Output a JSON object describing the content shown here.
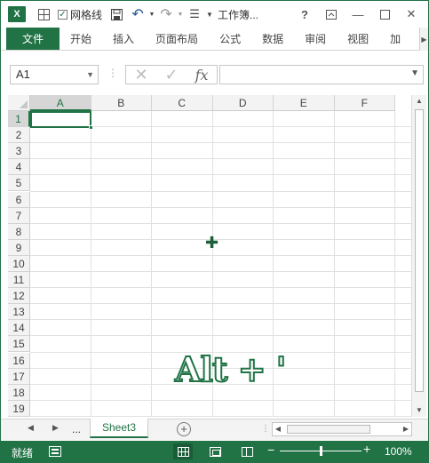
{
  "titlebar": {
    "app_icon_label": "X",
    "gridlines_label": "网格线",
    "gridlines_checked": true,
    "title": "工作簿...",
    "help": "?",
    "icons": [
      "excel-logo",
      "table-icon",
      "save-icon",
      "undo-icon",
      "redo-icon",
      "customize-qat-icon",
      "help-icon",
      "ribbon-display-icon",
      "minimize-icon",
      "maximize-icon",
      "close-icon"
    ]
  },
  "ribbon": {
    "tabs": [
      "文件",
      "开始",
      "插入",
      "页面布局",
      "公式",
      "数据",
      "审阅",
      "视图",
      "加"
    ]
  },
  "formula_bar": {
    "name_box": "A1",
    "fx": "fx",
    "formula_value": ""
  },
  "grid": {
    "columns": [
      "A",
      "B",
      "C",
      "D",
      "E",
      "F"
    ],
    "rows": [
      "1",
      "2",
      "3",
      "4",
      "5",
      "6",
      "7",
      "8",
      "9",
      "10",
      "11",
      "12",
      "13",
      "14",
      "15",
      "16",
      "17",
      "18",
      "19"
    ],
    "active_cell": "A1",
    "accent_color": "#217346"
  },
  "overlay": {
    "shortcut": "Alt + '"
  },
  "sheet_bar": {
    "ellipsis": "...",
    "tabs": [
      "Sheet3"
    ],
    "active_tab": "Sheet3"
  },
  "status_bar": {
    "status": "就绪",
    "zoom_minus": "−",
    "zoom_plus": "+",
    "zoom": "100%",
    "zoom_fraction": 0.5
  }
}
